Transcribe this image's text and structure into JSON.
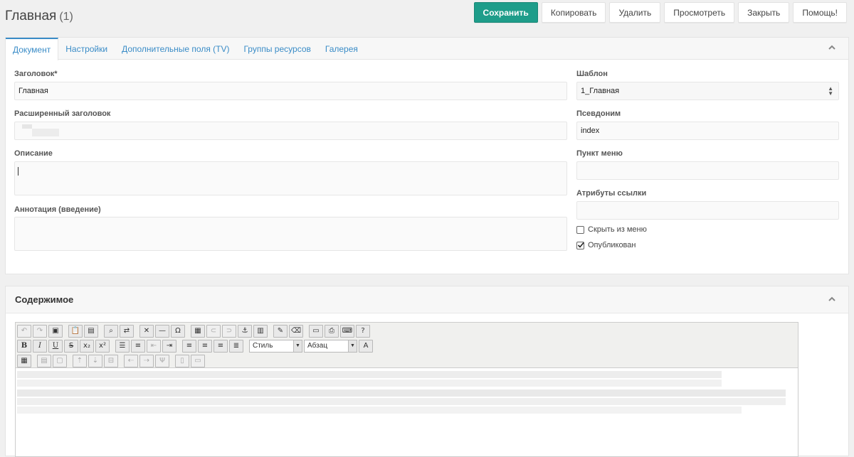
{
  "header": {
    "title": "Главная",
    "count": "(1)"
  },
  "toolbar": {
    "save": "Сохранить",
    "copy": "Копировать",
    "delete": "Удалить",
    "view": "Просмотреть",
    "close": "Закрыть",
    "help": "Помощь!"
  },
  "tabs": [
    {
      "label": "Документ"
    },
    {
      "label": "Настройки"
    },
    {
      "label": "Дополнительные поля (TV)"
    },
    {
      "label": "Группы ресурсов"
    },
    {
      "label": "Галерея"
    }
  ],
  "form": {
    "title_label": "Заголовок*",
    "title_value": "Главная",
    "longtitle_label": "Расширенный заголовок",
    "description_label": "Описание",
    "introtext_label": "Аннотация (введение)",
    "template_label": "Шаблон",
    "template_value": "1_Главная",
    "alias_label": "Псевдоним",
    "alias_value": "index",
    "menutitle_label": "Пункт меню",
    "link_attributes_label": "Атрибуты ссылки",
    "hide_menu_label": "Скрыть из меню",
    "hide_menu_checked": false,
    "published_label": "Опубликован",
    "published_checked": true
  },
  "content": {
    "title": "Содержимое",
    "style_select": "Стиль",
    "format_select": "Абзац"
  },
  "icons": {
    "collapse": "chevron-up-icon",
    "check": "checkmark-icon"
  },
  "colors": {
    "primary_button": "#1e9d8a",
    "tab_link": "#3a8cc7"
  }
}
